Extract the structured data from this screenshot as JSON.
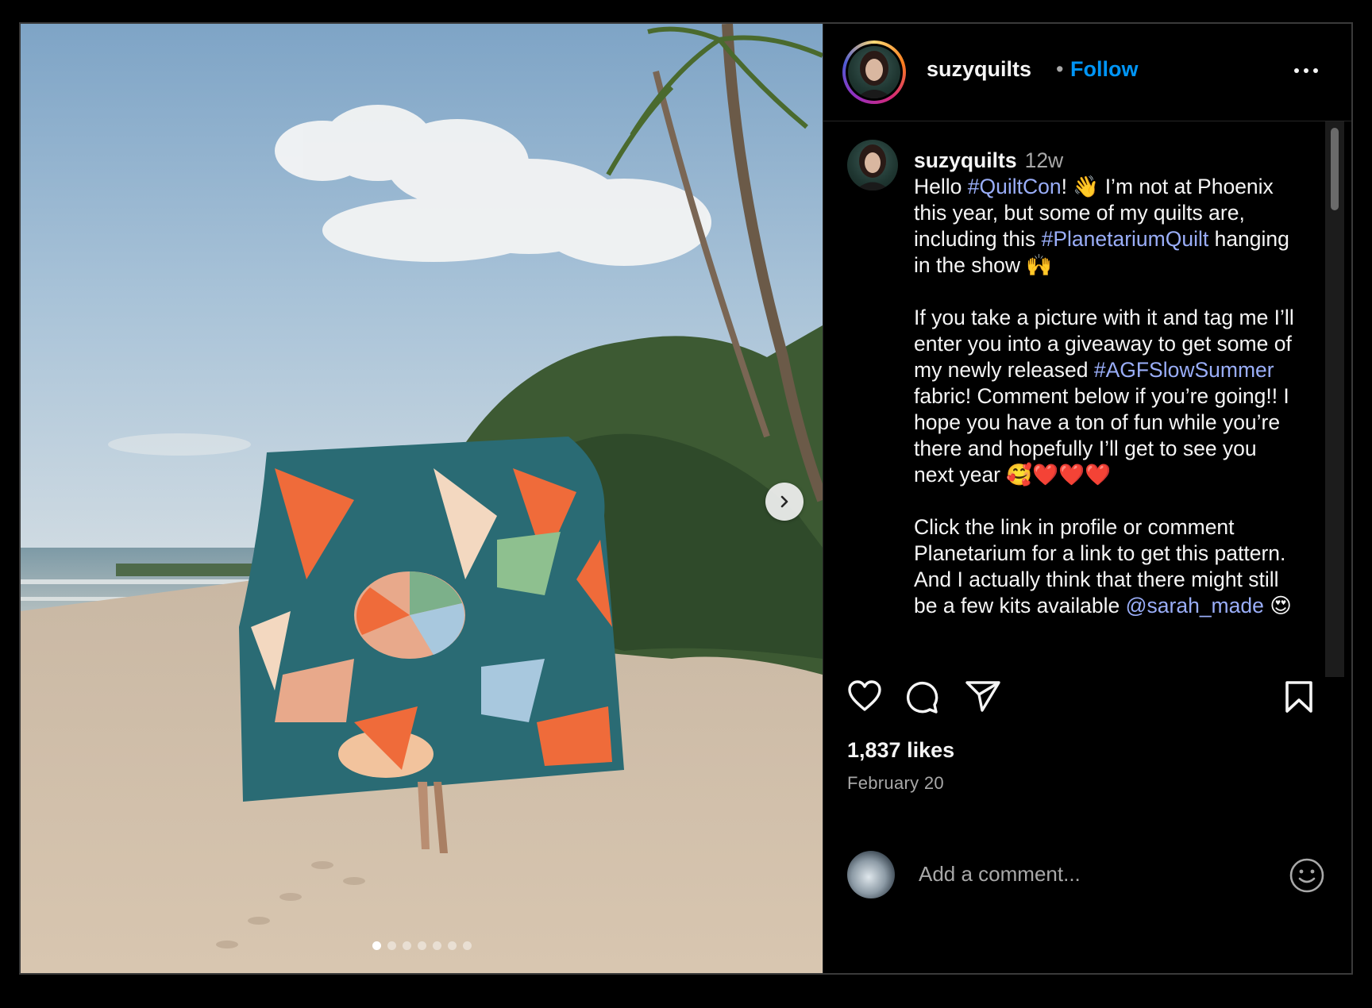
{
  "post": {
    "image_alt": "Person holding a colorful geometric quilt on a beach with palm trees",
    "carousel": {
      "total_slides": 7,
      "current_index": 0
    },
    "next_button": "next-arrow"
  },
  "header": {
    "username": "suzyquilts",
    "separator": "•",
    "follow_label": "Follow"
  },
  "caption": {
    "username": "suzyquilts",
    "time": "12w",
    "p1_a": "Hello ",
    "tag1": "#QuiltCon",
    "p1_b": "! 👋 I’m not at Phoenix this year, but some of my quilts are, including this ",
    "tag2": "#PlanetariumQuilt",
    "p1_c": " hanging in the show 🙌",
    "p2_a": "If you take a picture with it and tag me I’ll enter you into a giveaway to get some of my newly released ",
    "tag3": "#AGFSlowSummer",
    "p2_b": " fabric! Comment below if you’re going!! I hope you have a ton of fun while you’re there and hopefully I’ll get to see you next year 🥰❤️❤️❤️",
    "p3_a": "Click the link in profile or comment Planetarium for a link to get this pattern. And I actually think that there might still be a few kits available ",
    "mention": "@sarah_made",
    "p3_b": " 😍"
  },
  "actions": {
    "icons": [
      "heart-icon",
      "comment-icon",
      "share-icon",
      "bookmark-icon"
    ]
  },
  "likes": "1,837 likes",
  "date": "February 20",
  "comment_box": {
    "placeholder": "Add a comment...",
    "emoji_icon": "smiley-icon"
  },
  "colors": {
    "follow": "#0095f6",
    "hashtag": "#9aaef9",
    "background": "#000000"
  }
}
